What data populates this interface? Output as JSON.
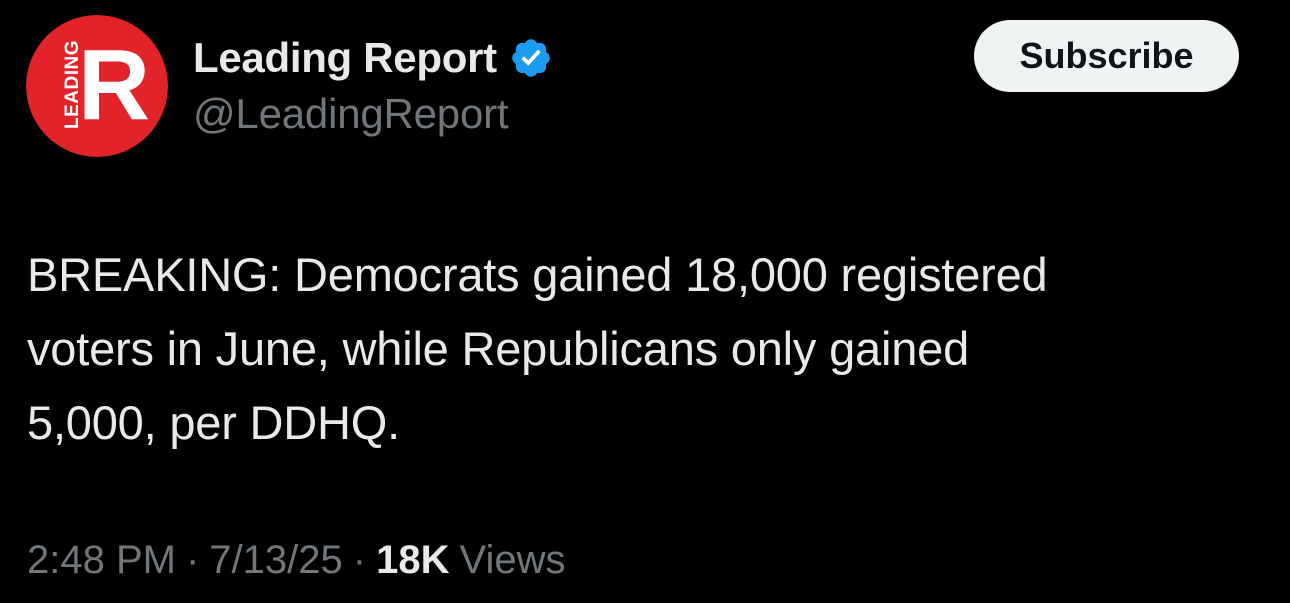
{
  "colors": {
    "background": "#000000",
    "primary_text": "#e7e9ea",
    "secondary_text": "#71767b",
    "verified_badge": "#1d9bf0",
    "avatar_red": "#e2232a",
    "subscribe_bg": "#eff3f4"
  },
  "author": {
    "display_name": "Leading Report",
    "handle": "@LeadingReport",
    "verified": true,
    "avatar_icon": "leading-report-logo",
    "avatar_letter": "R",
    "avatar_side_text": "LEADING"
  },
  "actions": {
    "subscribe_label": "Subscribe"
  },
  "tweet": {
    "text": "BREAKING: Democrats gained 18,000 registered\nvoters in June, while Republicans only gained\n5,000, per DDHQ."
  },
  "meta": {
    "time": "2:48 PM",
    "separator": "·",
    "date": "7/13/25",
    "views_count": "18K",
    "views_label": "Views"
  }
}
